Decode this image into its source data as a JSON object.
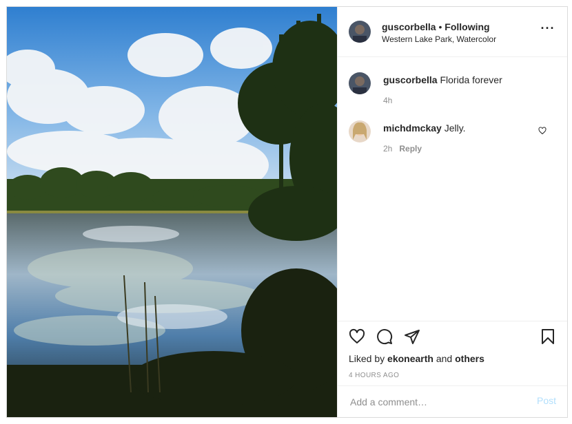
{
  "post": {
    "username": "guscorbella",
    "separator": " • ",
    "follow_status": "Following",
    "location": "Western Lake Park, Watercolor",
    "more_icon": "more-horizontal-icon",
    "photo_alt": "photo"
  },
  "comments": [
    {
      "username": "guscorbella",
      "text": " Florida forever",
      "time": "4h"
    },
    {
      "username": "michdmckay",
      "text": " Jelly.",
      "time": "2h",
      "reply_label": "Reply"
    }
  ],
  "actions": {
    "like_icon": "heart-icon",
    "comment_icon": "comment-icon",
    "share_icon": "send-icon",
    "save_icon": "bookmark-icon"
  },
  "likes": {
    "prefix": "Liked by ",
    "user": "ekonearth",
    "middle": " and ",
    "others": "others"
  },
  "timestamp": "4 HOURS AGO",
  "add_comment": {
    "placeholder": "Add a comment…",
    "post_label": "Post"
  },
  "colors": {
    "post_disabled": "#b2dffc",
    "meta_gray": "#8e8e8e",
    "border": "#dbdbdb"
  }
}
